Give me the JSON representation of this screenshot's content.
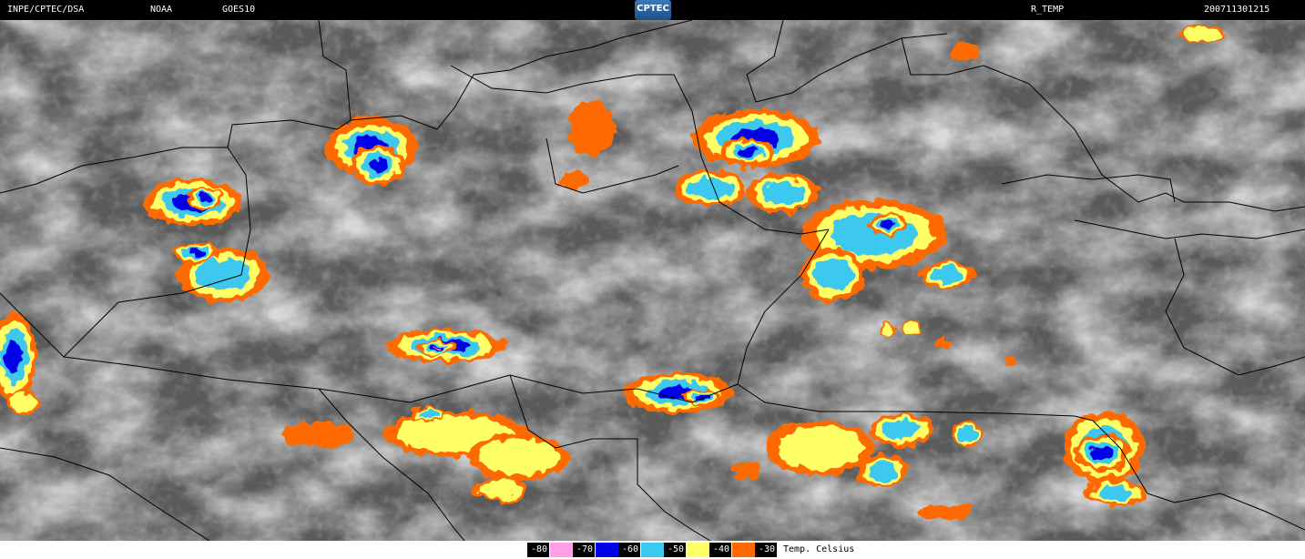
{
  "header": {
    "source": "INPE/CPTEC/DSA",
    "agency": "NOAA",
    "satellite": "GOES10",
    "logo_text": "CPTEC",
    "product": "R_TEMP",
    "timestamp": "200711301215"
  },
  "colors": {
    "minus80": "#ff9fe8",
    "minus70": "#0000e6",
    "minus60": "#3cc8f0",
    "minus50": "#ffff66",
    "minus40": "#ff6a00",
    "border_lines": "#000000"
  },
  "legend": {
    "items": [
      {
        "label": "-80",
        "color": "#ff9fe8"
      },
      {
        "label": "-70",
        "color": "#0000e6"
      },
      {
        "label": "-60",
        "color": "#3cc8f0"
      },
      {
        "label": "-50",
        "color": "#ffff66"
      },
      {
        "label": "-40",
        "color": "#ff6a00"
      },
      {
        "label": "-30",
        "color": null
      }
    ],
    "title": "Temp. Celsius"
  }
}
